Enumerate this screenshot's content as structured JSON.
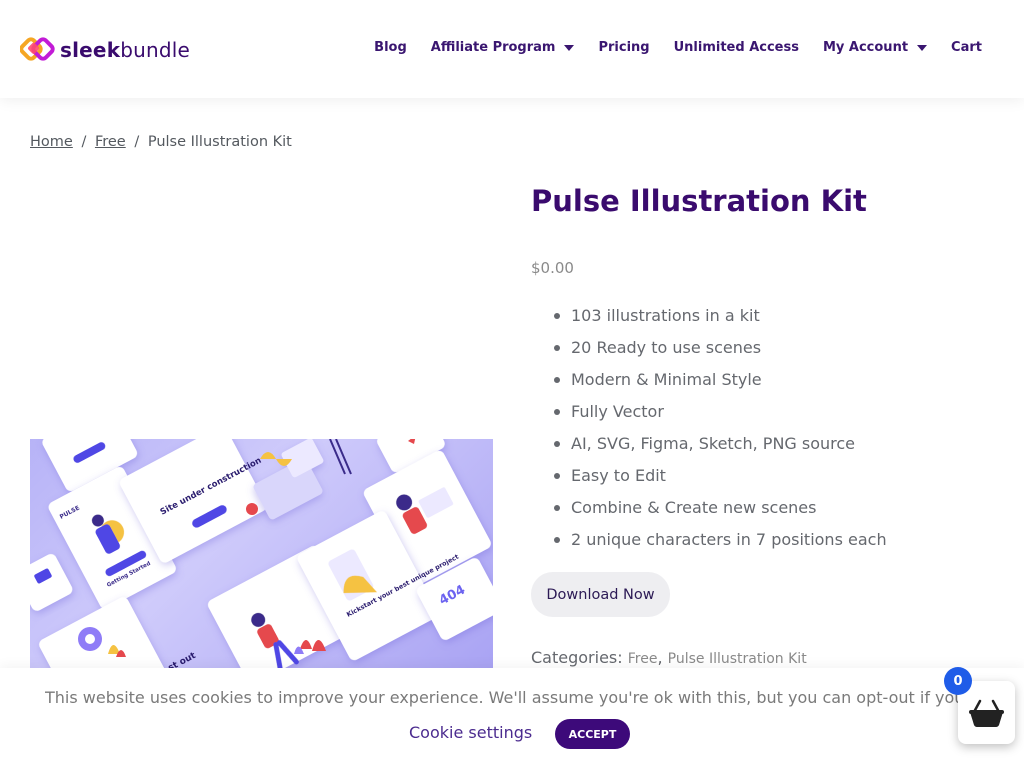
{
  "brand": {
    "name_bold": "sleek",
    "name_light": "bundle"
  },
  "nav": {
    "items": [
      {
        "label": "Blog",
        "has_dropdown": false
      },
      {
        "label": "Affiliate Program",
        "has_dropdown": true
      },
      {
        "label": "Pricing",
        "has_dropdown": false
      },
      {
        "label": "Unlimited Access",
        "has_dropdown": false
      },
      {
        "label": "My Account",
        "has_dropdown": true
      },
      {
        "label": "Cart",
        "has_dropdown": false
      }
    ]
  },
  "breadcrumb": {
    "home": "Home",
    "sep1": "/",
    "category": "Free",
    "sep2": "/",
    "current": "Pulse Illustration Kit"
  },
  "product": {
    "title": "Pulse Illustration Kit",
    "price": "$0.00",
    "features": [
      "103 illustrations in a kit",
      "20 Ready to use scenes",
      "Modern & Minimal Style",
      "Fully Vector",
      "AI, SVG, Figma, Sketch, PNG source",
      "Easy to Edit",
      "Combine & Create new scenes",
      "2 unique characters in 7 positions each"
    ],
    "download_label": "Download Now",
    "categories_label": "Categories:",
    "categories": [
      "Free",
      "Pulse Illustration Kit"
    ],
    "categories_sep": ","
  },
  "preview": {
    "card_site_title": "Site under construction",
    "card_kickstart": "Kickstart your best unique project",
    "card_getting_started": "Getting Started",
    "card_out": "st out",
    "card_404": "404",
    "brand_small": "PULSE"
  },
  "cookie": {
    "text": "This website uses cookies to improve your experience. We'll assume you're ok with this, but you can opt-out if you wish.",
    "settings_label": "Cookie settings",
    "accept_label": "ACCEPT"
  },
  "cart_widget": {
    "count": "0"
  },
  "colors": {
    "brand_purple": "#3a0b6e",
    "accept_bg": "#3d0a7a",
    "cart_badge": "#1f5ce8",
    "download_bg": "#eeeef1"
  }
}
